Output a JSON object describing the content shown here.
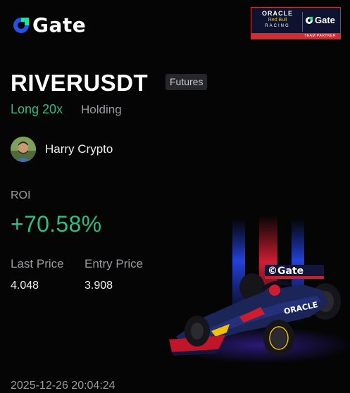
{
  "brand": {
    "name": "Gate",
    "mark_icon": "gate-logo-icon"
  },
  "partner": {
    "oracle": "ORACLE",
    "red_bull": "Red Bull",
    "racing": "RACING",
    "gate": "Gate",
    "footer": "TEAM PARTNER"
  },
  "position": {
    "pair": "RIVERUSDT",
    "tag": "Futures",
    "side": "Long 20x",
    "status": "Holding"
  },
  "user": {
    "name": "Harry Crypto"
  },
  "roi": {
    "label": "ROI",
    "value": "+70.58%"
  },
  "prices": {
    "last_label": "Last Price",
    "last_value": "4.048",
    "entry_label": "Entry Price",
    "entry_value": "3.908"
  },
  "car_livery": "©Gate",
  "car_sidepod": "ORACLE",
  "timestamp": "2025-12-26 20:04:24",
  "colors": {
    "accent_green": "#2fbd86",
    "background": "#050505",
    "muted_text": "#9a9aa0",
    "gate_blue": "#2354e6",
    "gate_green": "#17e6a1"
  }
}
